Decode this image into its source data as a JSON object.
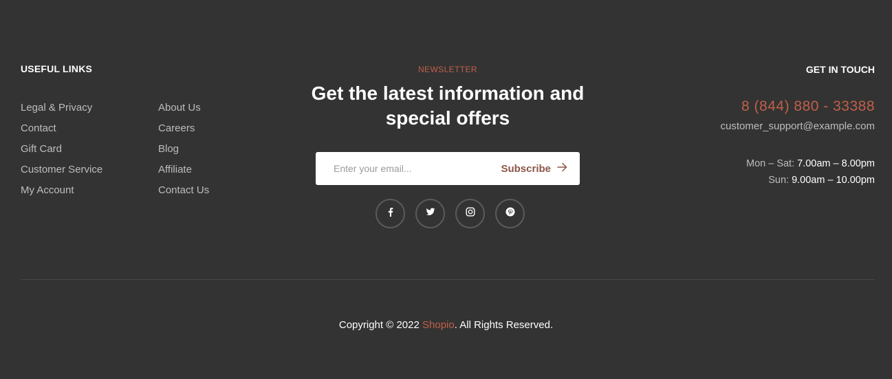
{
  "colors": {
    "background": "#333333",
    "accent": "#c0604a",
    "muted_text": "#bdbdbd",
    "subscribe_text": "#8c5548",
    "divider": "#4a4a4a"
  },
  "useful_links": {
    "title": "USEFUL LINKS",
    "column_1": [
      "Legal & Privacy",
      "Contact",
      "Gift Card",
      "Customer Service",
      "My Account"
    ],
    "column_2": [
      "About Us",
      "Careers",
      "Blog",
      "Affiliate",
      "Contact Us"
    ]
  },
  "newsletter": {
    "eyebrow": "NEWSLETTER",
    "title": "Get the latest information and special offers",
    "email_placeholder": "Enter your email...",
    "email_value": "",
    "subscribe_label": "Subscribe",
    "subscribe_icon": "arrow-right-icon",
    "socials": [
      {
        "name": "facebook",
        "icon": "facebook-icon"
      },
      {
        "name": "twitter",
        "icon": "twitter-icon"
      },
      {
        "name": "instagram",
        "icon": "instagram-icon"
      },
      {
        "name": "pinterest",
        "icon": "pinterest-icon"
      }
    ]
  },
  "contact": {
    "title": "GET IN TOUCH",
    "phone": "8 (844) 880 - 33388",
    "email": "customer_support@example.com",
    "hours": [
      {
        "label": "Mon – Sat: ",
        "value": "7.00am – 8.00pm"
      },
      {
        "label": "Sun: ",
        "value": "9.00am – 10.00pm"
      }
    ]
  },
  "copyright": {
    "prefix": "Copyright © 2022 ",
    "brand": "Shopio",
    "suffix": ". All Rights Reserved."
  }
}
